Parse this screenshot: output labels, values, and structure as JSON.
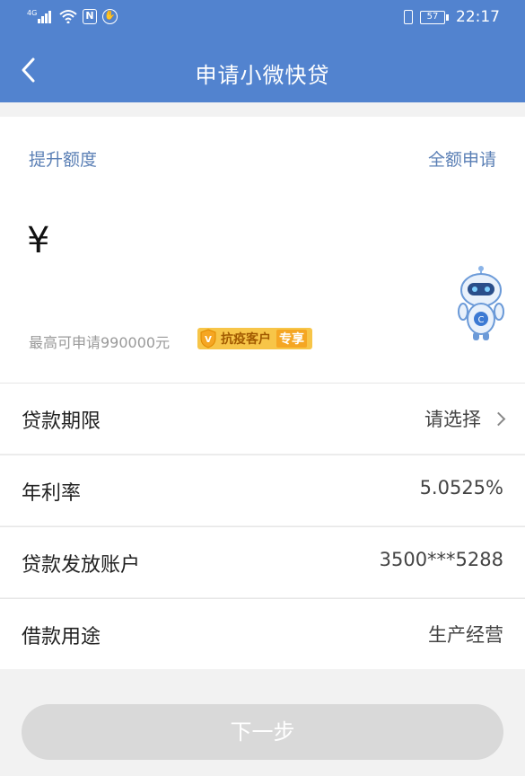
{
  "status_bar": {
    "network": "4G",
    "nfc": "N",
    "battery": "57",
    "time": "22:17"
  },
  "nav": {
    "back_icon": "chevron-left-icon",
    "title": "申请小微快贷"
  },
  "card": {
    "raise_limit_link": "提升额度",
    "full_apply_link": "全额申请",
    "currency_symbol": "¥",
    "max_apply_text": "最高可申请990000元",
    "badge_text": "抗疫客户",
    "badge_tag": "专享",
    "mascot": "robot-mascot-icon"
  },
  "form": {
    "rows": [
      {
        "label": "贷款期限",
        "value": "请选择"
      },
      {
        "label": "年利率",
        "value": "5.0525%"
      },
      {
        "label": "贷款发放账户",
        "value": "3500***5288"
      },
      {
        "label": "借款用途",
        "value": "生产经营"
      }
    ]
  },
  "actions": {
    "next_label": "下一步"
  },
  "colors": {
    "header": "#5283cf",
    "link": "#5a7fb5",
    "badge": "#f7c548",
    "disabled_button": "#d9d9d9"
  }
}
